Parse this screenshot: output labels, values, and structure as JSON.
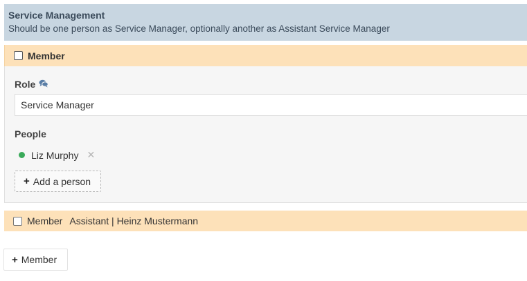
{
  "section": {
    "title": "Service Management",
    "subtitle": "Should be one person as Service Manager, optionally another as Assistant Service Manager"
  },
  "member_expanded": {
    "label": "Member",
    "role_label": "Role",
    "role_icon": "comments-icon",
    "role_value": "Service Manager",
    "people_label": "People",
    "people": [
      {
        "name": "Liz Murphy",
        "status_color": "#3aaa5a"
      }
    ],
    "add_person_label": "Add a person"
  },
  "member_collapsed": {
    "label": "Member",
    "summary": "Assistant | Heinz Mustermann"
  },
  "add_member_label": "Member",
  "colors": {
    "header_bg": "#c8d6e1",
    "member_bar_bg": "#fde1b9",
    "status_online": "#3aaa5a"
  }
}
